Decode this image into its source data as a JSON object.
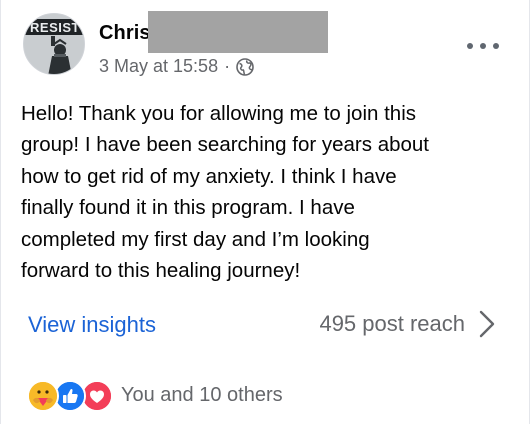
{
  "post": {
    "author_name": "Chris",
    "timestamp": "3 May at 15:58",
    "separator": "·",
    "audience_icon": "globe-icon",
    "avatar_text": "RESIST",
    "more_icon": "more-options-icon",
    "text_lines": [
      "Hello! Thank you for allowing me to join this",
      "group! I have been searching for years about",
      "how to get rid of my anxiety. I think I have",
      "finally found it in this program. I have",
      "completed my first day and I’m looking",
      "forward to this healing journey!"
    ]
  },
  "insights": {
    "link_label": "View insights",
    "reach_label": "495 post reach",
    "chevron_icon": "chevron-right-icon"
  },
  "reactions": {
    "icons": [
      "care-reaction-icon",
      "like-reaction-icon",
      "love-reaction-icon"
    ],
    "summary": "You and 10 others"
  },
  "colors": {
    "link_blue": "#1b63d6",
    "meta_gray": "#65676b",
    "text_black": "#050505",
    "like_blue": "#1877f2",
    "love_red": "#f33e58",
    "care_yellow": "#f7b928"
  }
}
